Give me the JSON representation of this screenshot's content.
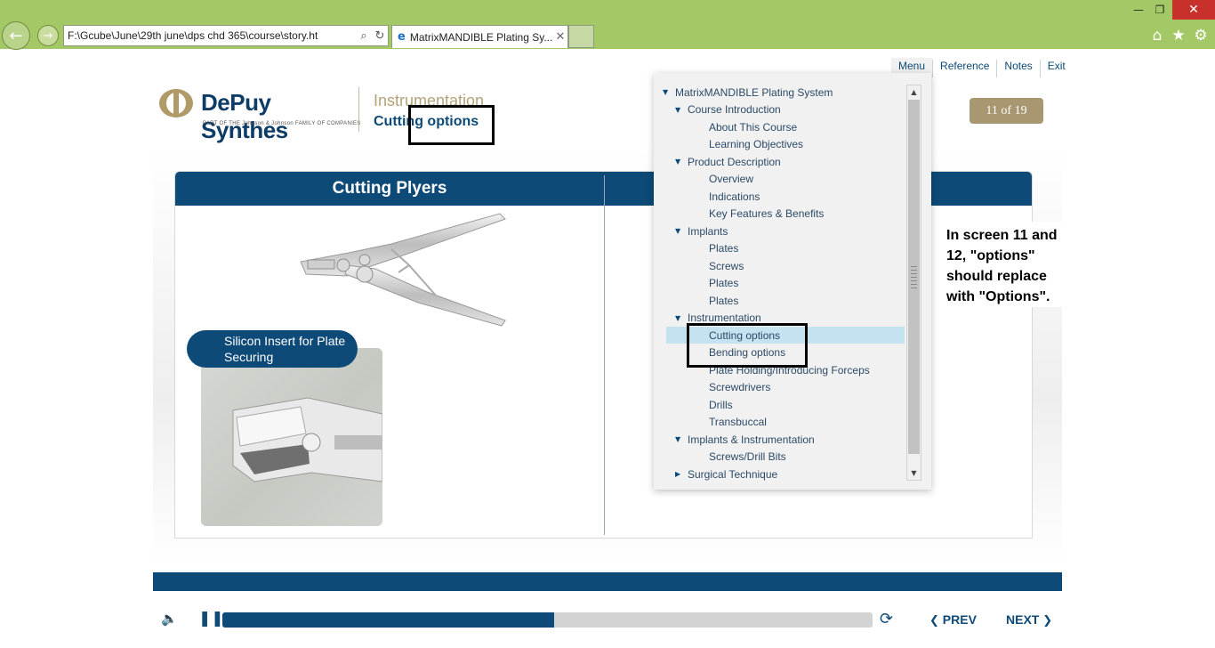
{
  "browser": {
    "address_url": "F:\\Gcube\\June\\29th june\\dps chd 365\\course\\story.ht",
    "tab_title": "MatrixMANDIBLE Plating Sy...",
    "icons": [
      "back-arrow-icon",
      "forward-arrow-icon",
      "search-icon",
      "refresh-icon",
      "ie-icon",
      "close-icon",
      "home-icon",
      "star-icon",
      "gear-icon"
    ]
  },
  "topmenu": {
    "menu": "Menu",
    "reference": "Reference",
    "notes": "Notes",
    "exit": "Exit"
  },
  "logo": {
    "name": "DePuy Synthes",
    "tagline": "PART OF THE Johnson & Johnson FAMILY OF COMPANIES"
  },
  "header": {
    "section": "Instrumentation",
    "title": "Cutting options"
  },
  "counter": "11 of 19",
  "slide": {
    "column_title": "Cutting Plyers",
    "callout": "Silicon Insert for Plate Securing"
  },
  "menu_tree": [
    {
      "label": "MatrixMANDIBLE Plating System",
      "level": 0,
      "caret": "▼"
    },
    {
      "label": "Course Introduction",
      "level": 1,
      "caret": "▼"
    },
    {
      "label": "About This Course",
      "level": 2,
      "caret": ""
    },
    {
      "label": "Learning Objectives",
      "level": 2,
      "caret": ""
    },
    {
      "label": "Product Description",
      "level": 1,
      "caret": "▼"
    },
    {
      "label": "Overview",
      "level": 2,
      "caret": ""
    },
    {
      "label": "Indications",
      "level": 2,
      "caret": ""
    },
    {
      "label": "Key Features & Benefits",
      "level": 2,
      "caret": ""
    },
    {
      "label": "Implants",
      "level": 1,
      "caret": "▼"
    },
    {
      "label": "Plates",
      "level": 2,
      "caret": ""
    },
    {
      "label": "Screws",
      "level": 2,
      "caret": ""
    },
    {
      "label": "Plates",
      "level": 2,
      "caret": ""
    },
    {
      "label": "Plates",
      "level": 2,
      "caret": ""
    },
    {
      "label": "Instrumentation",
      "level": 1,
      "caret": "▼"
    },
    {
      "label": "Cutting options",
      "level": 2,
      "caret": "",
      "selected": true
    },
    {
      "label": "Bending options",
      "level": 2,
      "caret": ""
    },
    {
      "label": "Plate Holding/Introducing Forceps",
      "level": 2,
      "caret": ""
    },
    {
      "label": "Screwdrivers",
      "level": 2,
      "caret": ""
    },
    {
      "label": "Drills",
      "level": 2,
      "caret": ""
    },
    {
      "label": "Transbuccal",
      "level": 2,
      "caret": ""
    },
    {
      "label": "Implants & Instrumentation",
      "level": 1,
      "caret": "▼"
    },
    {
      "label": "Screws/Drill Bits",
      "level": 2,
      "caret": ""
    },
    {
      "label": "Surgical Technique",
      "level": 1,
      "caret": "▶"
    }
  ],
  "annotation_note": "In screen 11 and 12, \"options\" should replace with \"Options\".",
  "player": {
    "progress_fraction": 0.51,
    "prev": "PREV",
    "next": "NEXT"
  },
  "colors": {
    "brand_blue": "#0d4a78",
    "gold": "#a89770",
    "chrome_green": "#a4c866",
    "selected_row": "#c5e2f1"
  }
}
